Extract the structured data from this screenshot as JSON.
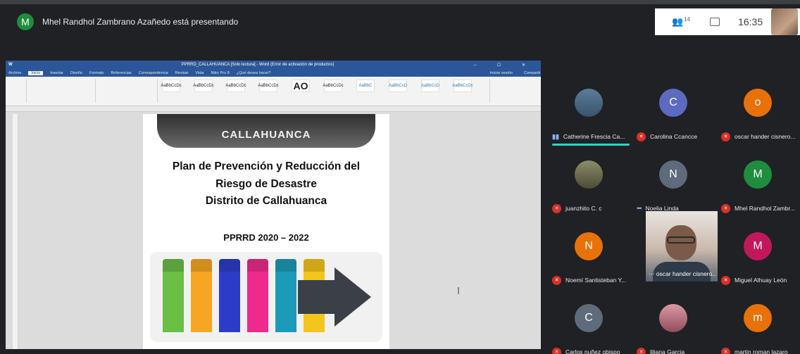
{
  "presenter": {
    "initial": "M",
    "text": "Mhel Randhol Zambrano Azañedo está presentando"
  },
  "toolbar": {
    "people_icon": "people-icon",
    "people_count": "14",
    "chat_icon": "chat-icon",
    "time": "16:35"
  },
  "word": {
    "title": "PPRRD_CALLAHUANCA [Solo lectura] - Word (Error de activación de productos)",
    "tabs": [
      "Archivo",
      "Inicio",
      "Insertar",
      "Diseño",
      "Formato",
      "Referencias",
      "Correspondencia",
      "Revisar",
      "Vista",
      "Nitro Pro 8",
      "¿Qué desea hacer?"
    ],
    "account": "Iniciar sesión",
    "share": "Compartir",
    "styles": [
      "AaBbCcDc",
      "AaBbCcDc",
      "AaBbCcDc",
      "AaBbCcDc",
      "AO",
      "AaBbCcDc",
      "AaBbC",
      "AaBbCcD",
      "AaBbCcD",
      "AaBbCcDc"
    ]
  },
  "document": {
    "logo_text": "CALLAHUANCA",
    "title_line1": "Plan de Prevención y Reducción del",
    "title_line2": "Riesgo de Desastre",
    "title_line3": "Distrito de Callahuanca",
    "years": "PPRRD  2020 – 2022",
    "infographic_colors": [
      "#6abf45",
      "#f6a623",
      "#2d3cc8",
      "#ee2a8c",
      "#1b9bb7",
      "#f4c51a"
    ]
  },
  "participants": [
    {
      "name": "Catherine Frescia Ca...",
      "initial": "",
      "status": "speaking",
      "avatar_color": "",
      "photo": true
    },
    {
      "name": "Carolina Ccancce",
      "initial": "C",
      "status": "muted",
      "avatar_color": "#5c6bc0"
    },
    {
      "name": "oscar hander cisnero...",
      "initial": "o",
      "status": "muted",
      "avatar_color": "#e8710a"
    },
    {
      "name": "juanzhito C. c",
      "initial": "",
      "status": "muted",
      "avatar_color": "",
      "photo": true
    },
    {
      "name": "Noelia Linda",
      "initial": "N",
      "status": "talking",
      "avatar_color": "#5f6b7a"
    },
    {
      "name": "Mhel Randhol Zambr...",
      "initial": "M",
      "status": "muted",
      "avatar_color": "#1e8e3e"
    },
    {
      "name": "Noemí Santisteban Y...",
      "initial": "N",
      "status": "muted",
      "avatar_color": "#e8710a"
    },
    {
      "name": "oscar hander cisnero...",
      "initial": "",
      "status": "talking",
      "avatar_color": "",
      "video": true
    },
    {
      "name": "Miguel Alhuay León",
      "initial": "M",
      "status": "muted",
      "avatar_color": "#c2185b"
    },
    {
      "name": "Carlos nuñez obispo",
      "initial": "C",
      "status": "muted",
      "avatar_color": "#5f6b7a"
    },
    {
      "name": "liliana Garcia",
      "initial": "",
      "status": "muted",
      "avatar_color": "",
      "photo": true
    },
    {
      "name": "martin roman lazaro",
      "initial": "m",
      "status": "muted",
      "avatar_color": "#e8710a"
    }
  ]
}
